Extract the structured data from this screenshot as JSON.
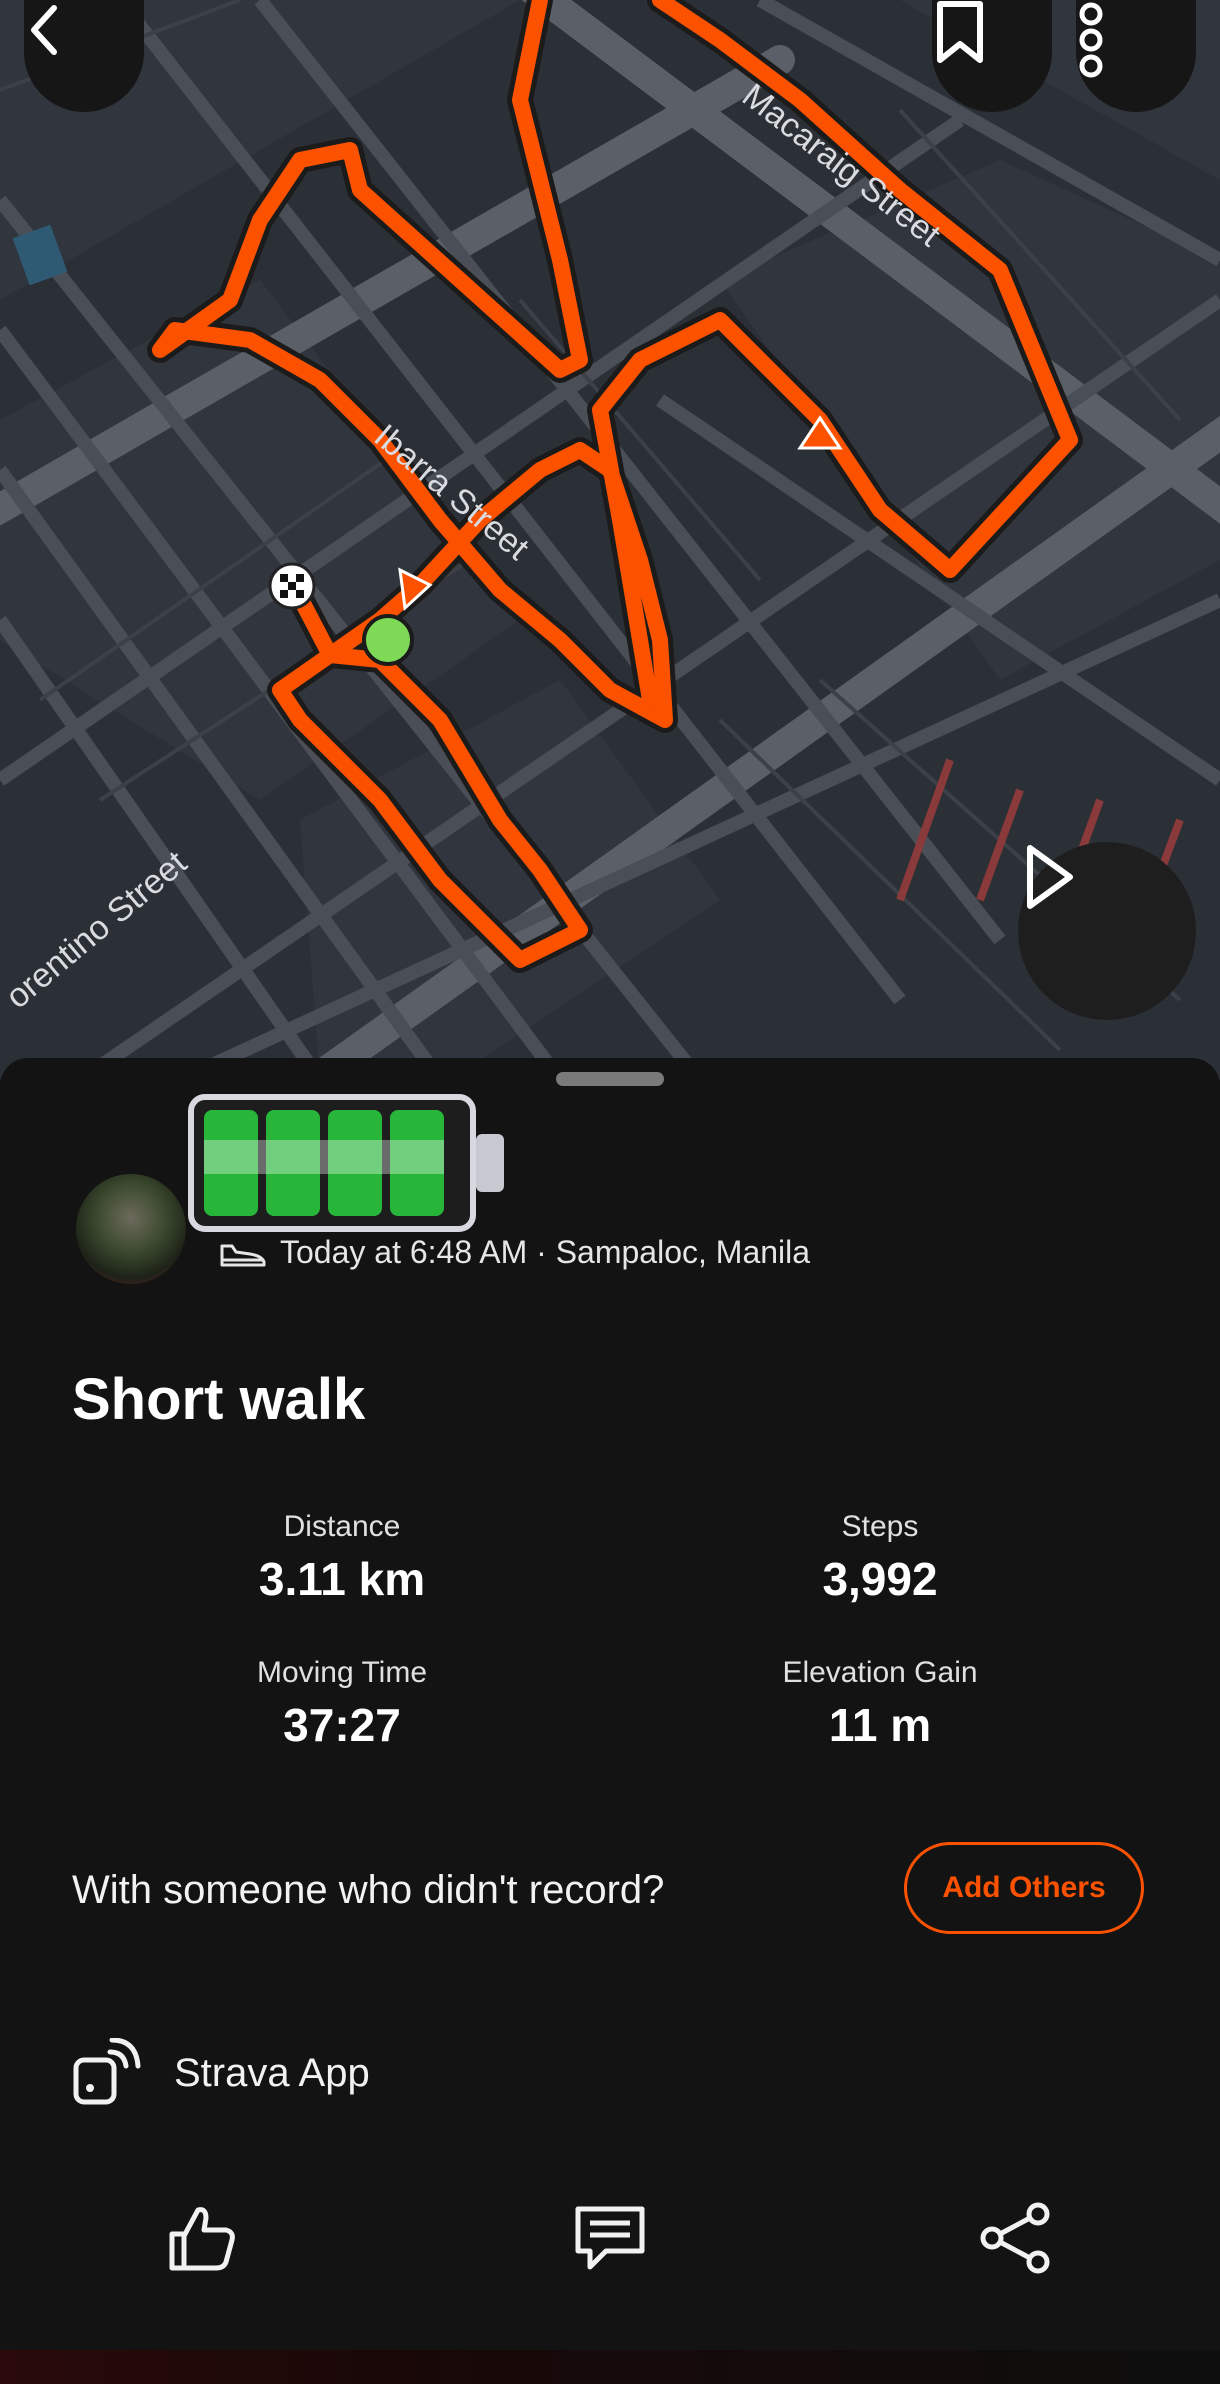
{
  "map": {
    "streets": {
      "macaraig": "Macaraig Street",
      "ibarra": "Ibarra Street",
      "florentino": "orentino Street"
    },
    "route_color": "#fc5200",
    "start_marker_color": "#7ed957"
  },
  "toolbar": {
    "back_icon": "chevron-left-icon",
    "bookmark_icon": "bookmark-icon",
    "more_icon": "more-vertical-icon",
    "play_icon": "play-icon"
  },
  "activity": {
    "meta": "Today at 6:48 AM · Sampaloc, Manila",
    "activity_icon": "shoe-icon",
    "title": "Short walk",
    "stats": {
      "distance_label": "Distance",
      "distance_value": "3.11 km",
      "steps_label": "Steps",
      "steps_value": "3,992",
      "moving_label": "Moving Time",
      "moving_value": "37:27",
      "elev_label": "Elevation Gain",
      "elev_value": "11 m"
    },
    "battery_level": 4
  },
  "others": {
    "prompt": "With someone who didn't record?",
    "button": "Add Others"
  },
  "device": {
    "label": "Strava App",
    "icon": "device-broadcast-icon"
  },
  "actions": {
    "kudos_icon": "thumbs-up-icon",
    "comment_icon": "comment-icon",
    "share_icon": "share-icon"
  },
  "colors": {
    "accent": "#fc5200",
    "background": "#131313",
    "map_background": "#2b2f36"
  }
}
